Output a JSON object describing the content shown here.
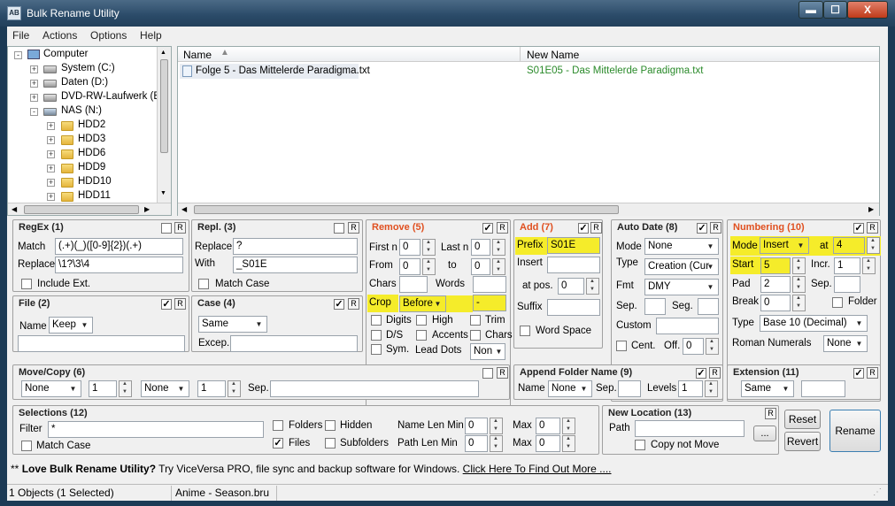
{
  "window": {
    "title": "Bulk Rename Utility",
    "app_icon": "AB",
    "btn_min": "▬",
    "btn_max": "☐",
    "btn_close": "X"
  },
  "menu": [
    "File",
    "Actions",
    "Options",
    "Help"
  ],
  "tree": {
    "items": [
      {
        "label": "Computer",
        "icon": "computer-icon"
      },
      {
        "label": "System (C:)",
        "icon": "drive-icon"
      },
      {
        "label": "Daten (D:)",
        "icon": "drive-icon"
      },
      {
        "label": "DVD-RW-Laufwerk (E",
        "icon": "dvd-drive-icon"
      },
      {
        "label": "NAS (N:)",
        "icon": "network-drive-icon"
      },
      {
        "label": "HDD2",
        "icon": "folder-icon"
      },
      {
        "label": "HDD3",
        "icon": "folder-icon"
      },
      {
        "label": "HDD6",
        "icon": "folder-icon"
      },
      {
        "label": "HDD9",
        "icon": "folder-icon"
      },
      {
        "label": "HDD10",
        "icon": "folder-icon"
      },
      {
        "label": "HDD11",
        "icon": "folder-icon"
      }
    ]
  },
  "filelist": {
    "col_name": "Name",
    "col_new": "New Name",
    "rows": [
      {
        "name": "Folge 5 - Das Mittelerde Paradigma.txt",
        "new_name": "S01E05 - Das Mittelerde Paradigma.txt"
      }
    ]
  },
  "regex": {
    "title": "RegEx (1)",
    "match_label": "Match",
    "match": "(.+)(_)([0-9]{2})(.+)",
    "replace_label": "Replace",
    "replace": "\\1?\\3\\4",
    "include_ext": "Include Ext."
  },
  "repl": {
    "title": "Repl. (3)",
    "replace_label": "Replace",
    "replace": "?",
    "with_label": "With",
    "with": "_S01E",
    "match_case": "Match Case"
  },
  "remove": {
    "title": "Remove (5)",
    "first_n": "First n",
    "first_n_val": "0",
    "last_n": "Last n",
    "last_n_val": "0",
    "from": "From",
    "from_val": "0",
    "to": "to",
    "to_val": "0",
    "chars": "Chars",
    "words": "Words",
    "crop": "Crop",
    "crop_val": "Before",
    "crop_text": "-",
    "digits": "Digits",
    "high": "High",
    "trim": "Trim",
    "ds": "D/S",
    "accents": "Accents",
    "chars2": "Chars",
    "sym": "Sym.",
    "lead_dots": "Lead Dots",
    "lead_dots_val": "Non"
  },
  "add": {
    "title": "Add (7)",
    "prefix": "Prefix",
    "prefix_val": "S01E",
    "insert": "Insert",
    "at_pos": "at pos.",
    "at_pos_val": "0",
    "suffix": "Suffix",
    "word_space": "Word Space"
  },
  "autodate": {
    "title": "Auto Date (8)",
    "mode": "Mode",
    "mode_val": "None",
    "type": "Type",
    "type_val": "Creation (Cur",
    "fmt": "Fmt",
    "fmt_val": "DMY",
    "sep": "Sep.",
    "seg": "Seg.",
    "custom": "Custom",
    "cent": "Cent.",
    "off": "Off.",
    "off_val": "0"
  },
  "numbering": {
    "title": "Numbering (10)",
    "mode": "Mode",
    "mode_val": "Insert",
    "at": "at",
    "at_val": "4",
    "start": "Start",
    "start_val": "5",
    "incr": "Incr.",
    "incr_val": "1",
    "pad": "Pad",
    "pad_val": "2",
    "sep": "Sep.",
    "brk": "Break",
    "brk_val": "0",
    "folder": "Folder",
    "type": "Type",
    "type_val": "Base 10 (Decimal)",
    "roman": "Roman Numerals",
    "roman_val": "None"
  },
  "file": {
    "title": "File (2)",
    "name": "Name",
    "name_val": "Keep"
  },
  "case": {
    "title": "Case (4)",
    "case_val": "Same",
    "excep": "Excep."
  },
  "movecopy": {
    "title": "Move/Copy (6)",
    "sel1": "None",
    "num1": "1",
    "sel2": "None",
    "num2": "1",
    "sep": "Sep."
  },
  "appendfolder": {
    "title": "Append Folder Name (9)",
    "name": "Name",
    "name_val": "None",
    "sep": "Sep.",
    "levels": "Levels",
    "levels_val": "1"
  },
  "extension": {
    "title": "Extension (11)",
    "ext_val": "Same"
  },
  "selections": {
    "title": "Selections (12)",
    "filter": "Filter",
    "filter_val": "*",
    "match_case": "Match Case",
    "folders": "Folders",
    "hidden": "Hidden",
    "files": "Files",
    "subfolders": "Subfolders",
    "name_len_min": "Name Len Min",
    "name_min_val": "0",
    "max1": "Max",
    "max1_val": "0",
    "path_len_min": "Path Len Min",
    "path_min_val": "0",
    "max2": "Max",
    "max2_val": "0"
  },
  "newlocation": {
    "title": "New Location (13)",
    "path": "Path",
    "browse": "...",
    "copy_not_move": "Copy not Move"
  },
  "buttons": {
    "reset": "Reset",
    "revert": "Revert",
    "rename": "Rename"
  },
  "promo": {
    "prefix": "** ",
    "bold": "Love Bulk Rename Utility?",
    "text": " Try ViceVersa PRO, file sync and backup software for Windows. ",
    "link": "Click Here To Find Out More ...."
  },
  "status": {
    "objects": "1 Objects (1 Selected)",
    "file": "Anime - Season.bru"
  },
  "colors": {
    "highlight": "#f5ec2a",
    "new_name": "#2a8a2a",
    "active_title": "#e05020"
  }
}
